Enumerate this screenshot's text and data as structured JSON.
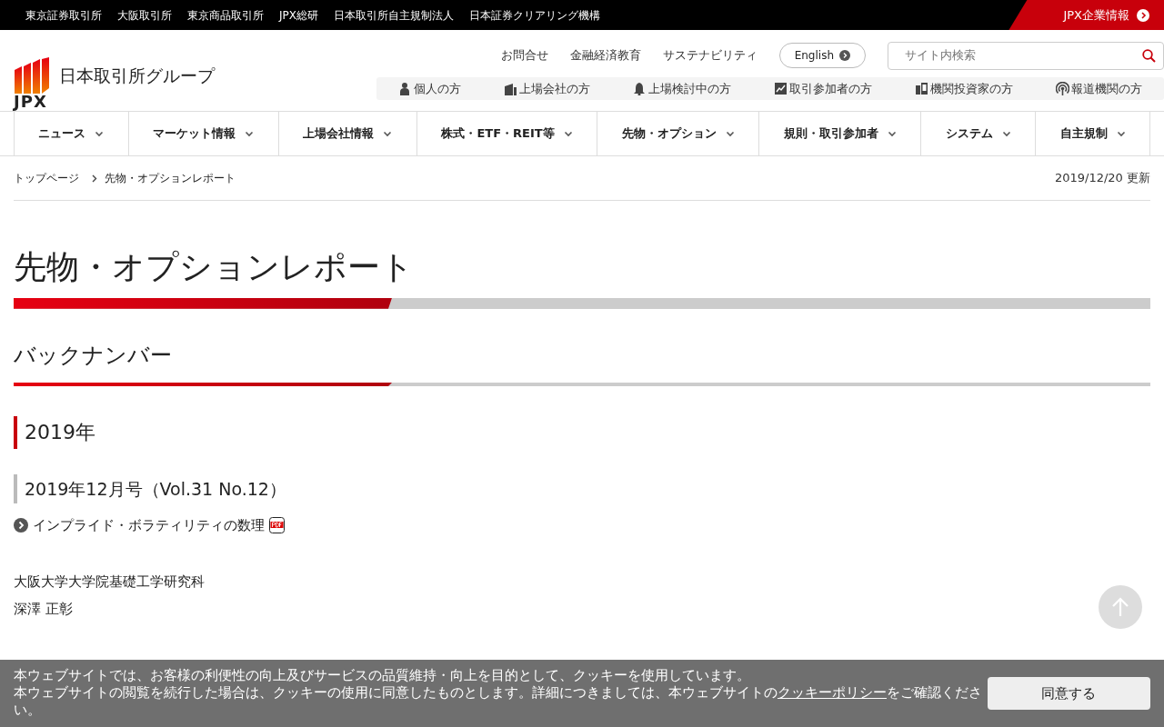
{
  "top_bar": {
    "links": [
      "東京証券取引所",
      "大阪取引所",
      "東京商品取引所",
      "JPX総研",
      "日本取引所自主規制法人",
      "日本証券クリアリング機構"
    ],
    "corporate_link": "JPX企業情報"
  },
  "header": {
    "logo_mark": "JPX",
    "logo_text": "日本取引所グループ",
    "utility_links": [
      "お問合せ",
      "金融経済教育",
      "サステナビリティ"
    ],
    "language_button": "English",
    "search": {
      "placeholder": "サイト内検索"
    }
  },
  "audience_links": [
    {
      "label": "個人の方",
      "kind": "person"
    },
    {
      "label": "上場会社の方",
      "kind": "building"
    },
    {
      "label": "上場検討中の方",
      "kind": "bell"
    },
    {
      "label": "取引参加者の方",
      "kind": "chart"
    },
    {
      "label": "機関投資家の方",
      "kind": "devices"
    },
    {
      "label": "報道機関の方",
      "kind": "broadcast"
    }
  ],
  "main_nav": [
    "ニュース",
    "マーケット情報",
    "上場会社情報",
    "株式・ETF・REIT等",
    "先物・オプション",
    "規則・取引参加者",
    "システム",
    "自主規制"
  ],
  "breadcrumb": [
    "トップページ",
    "先物・オプションレポート"
  ],
  "updated": "2019/12/20 更新",
  "page_title": "先物・オプションレポート",
  "section_title": "バックナンバー",
  "year_heading": "2019年",
  "issues": [
    {
      "title": "2019年12月号（Vol.31 No.12）",
      "articles": [
        "インプライド・ボラティリティの数理"
      ],
      "authors": [
        "大阪大学大学院基礎工学研究科",
        "深澤 正彰"
      ]
    }
  ],
  "cookie_banner": {
    "message": "本ウェブサイトでは、お客様の利便性の向上及びサービスの品質維持・向上を目的として、クッキーを使用しています。",
    "notice": "本ウェブサイトの閲覧を続行した場合は、クッキーの使用に同意したものとします。詳細につきましては、本ウェブサイトの",
    "policy_link": "クッキーポリシー",
    "notice_end": "をご確認ください。",
    "agree_button": "同意する"
  }
}
